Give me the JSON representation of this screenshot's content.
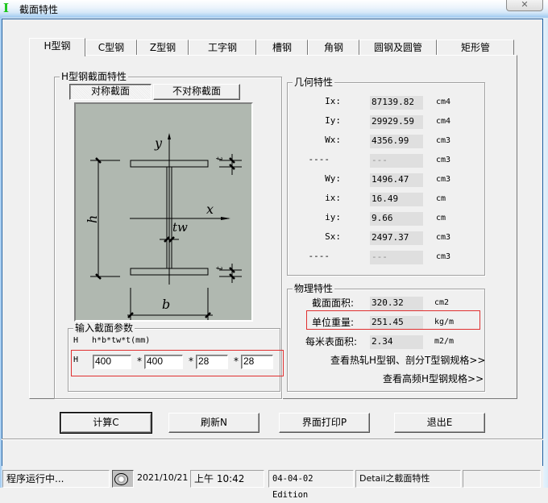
{
  "window": {
    "title": "截面特性",
    "app_icon": "I-beam-icon",
    "close_glyph": "✕"
  },
  "tabs": [
    {
      "label": "H型钢",
      "active": true
    },
    {
      "label": "C型钢",
      "active": false
    },
    {
      "label": "Z型钢",
      "active": false
    },
    {
      "label": "工字钢",
      "active": false
    },
    {
      "label": "槽钢",
      "active": false
    },
    {
      "label": "角钢",
      "active": false
    },
    {
      "label": "圆钢及圆管",
      "active": false
    },
    {
      "label": "矩形管",
      "active": false
    }
  ],
  "section_group": {
    "title": "H型钢截面特性",
    "symmetric_button": "对称截面",
    "asymmetric_button": "不对称截面",
    "diagram_labels": {
      "y": "y",
      "x": "x",
      "h": "h",
      "b": "b",
      "tw": "tw",
      "t_top": "t",
      "t_bottom": "t"
    }
  },
  "input_group": {
    "title": "输入截面参数",
    "formula_prefix": "H",
    "formula": "h*b*tw*t(mm)",
    "row_prefix": "H",
    "separator": "*",
    "values": [
      "400",
      "400",
      "28",
      "28"
    ]
  },
  "geometry": {
    "title": "几何特性",
    "rows": [
      {
        "label": "Ix:",
        "value": "87139.82",
        "unit": "cm4",
        "dim": false
      },
      {
        "label": "Iy:",
        "value": "29929.59",
        "unit": "cm4",
        "dim": false
      },
      {
        "label": "Wx:",
        "value": "4356.99",
        "unit": "cm3",
        "dim": false
      },
      {
        "label": "----",
        "value": "---",
        "unit": "cm3",
        "dim": true
      },
      {
        "label": "Wy:",
        "value": "1496.47",
        "unit": "cm3",
        "dim": false
      },
      {
        "label": "ix:",
        "value": "16.49",
        "unit": "cm",
        "dim": false
      },
      {
        "label": "iy:",
        "value": "9.66",
        "unit": "cm",
        "dim": false
      },
      {
        "label": "Sx:",
        "value": "2497.37",
        "unit": "cm3",
        "dim": false
      },
      {
        "label": "----",
        "value": "---",
        "unit": "cm3",
        "dim": true
      }
    ]
  },
  "physical": {
    "title": "物理特性",
    "rows": [
      {
        "label": "截面面积:",
        "value": "320.32",
        "unit": "cm2"
      },
      {
        "label": "单位重量:",
        "value": "251.45",
        "unit": "kg/m"
      },
      {
        "label": "每米表面积:",
        "value": "2.34",
        "unit": "m2/m"
      }
    ],
    "link_hot_rolled": "查看热轧H型钢、剖分T型钢规格>>",
    "link_high_freq": "查看高频H型钢规格>>"
  },
  "buttons": {
    "calculate": "计算C",
    "refresh": "刷新N",
    "print": "界面打印P",
    "exit": "退出E"
  },
  "statusbar": {
    "status": "程序运行中...",
    "timer_icon": "stopwatch-icon",
    "date": "2021/10/21",
    "time": "上午 10:42",
    "edition": "04-04-02 Edition",
    "module": "Detail之截面特性",
    "extra": ""
  },
  "colors": {
    "highlight_box": "#e03030",
    "diagram_bg": "#b0b8b0",
    "title_icon": "#19c519"
  }
}
